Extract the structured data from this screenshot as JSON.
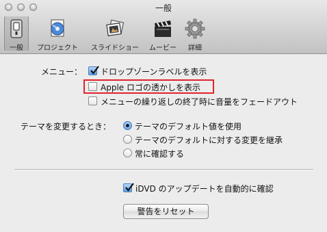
{
  "window": {
    "title": "一般"
  },
  "toolbar": {
    "items": [
      {
        "label": "一般",
        "icon": "general-switch-icon"
      },
      {
        "label": "プロジェクト",
        "icon": "project-document-icon"
      },
      {
        "label": "スライドショー",
        "icon": "slideshow-icon"
      },
      {
        "label": "ムービー",
        "icon": "movie-clapper-icon"
      },
      {
        "label": "詳細",
        "icon": "gear-icon"
      }
    ],
    "selected": "一般"
  },
  "menu": {
    "label": "メニュー：",
    "options": [
      {
        "label": "ドロップゾーンラベルを表示",
        "checked": true
      },
      {
        "label": "Apple ロゴの透かしを表示",
        "checked": false
      },
      {
        "label": "メニューの繰り返しの終了時に音量をフェードアウト",
        "checked": false
      }
    ]
  },
  "theme_change": {
    "label": "テーマを変更するとき：",
    "options": [
      {
        "label": "テーマのデフォルト値を使用",
        "selected": true
      },
      {
        "label": "テーマのデフォルトに対する変更を継承",
        "selected": false
      },
      {
        "label": "常に確認する",
        "selected": false
      }
    ]
  },
  "update": {
    "label": "iDVD のアップデートを自動的に確認",
    "checked": true
  },
  "reset_button": {
    "label": "警告をリセット"
  },
  "colors": {
    "highlight_border": "#e0232b",
    "checkbox_accent": "#5c9fe5"
  }
}
